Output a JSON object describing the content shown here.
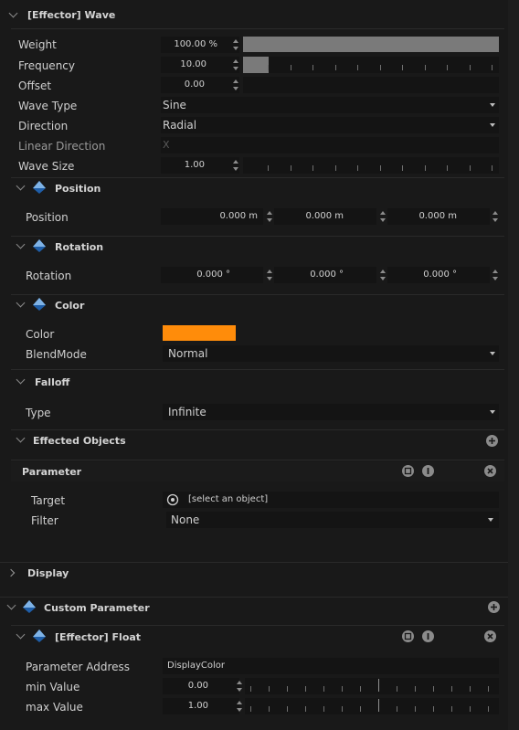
{
  "header": {
    "title": "[Effector] Wave"
  },
  "wave": {
    "weight": {
      "label": "Weight",
      "value": "100.00 %",
      "fill": 1.0
    },
    "frequency": {
      "label": "Frequency",
      "value": "10.00",
      "fill": 0.1
    },
    "offset": {
      "label": "Offset",
      "value": "0.00"
    },
    "wave_type": {
      "label": "Wave Type",
      "value": "Sine"
    },
    "direction": {
      "label": "Direction",
      "value": "Radial"
    },
    "linear_direction": {
      "label": "Linear Direction",
      "value": "X"
    },
    "wave_size": {
      "label": "Wave Size",
      "value": "1.00"
    }
  },
  "position": {
    "section": "Position",
    "label": "Position",
    "x": "0.000 m",
    "y": "0.000 m",
    "z": "0.000 m"
  },
  "rotation": {
    "section": "Rotation",
    "label": "Rotation",
    "x": "0.000 °",
    "y": "0.000 °",
    "z": "0.000 °"
  },
  "color": {
    "section": "Color",
    "label": "Color",
    "swatch": "#ff8c0a",
    "blendmode_label": "BlendMode",
    "blendmode": "Normal"
  },
  "falloff": {
    "section": "Falloff",
    "type_label": "Type",
    "type": "Infinite"
  },
  "effected": {
    "section": "Effected Objects",
    "parameter": "Parameter",
    "target_label": "Target",
    "target": "[select an object]",
    "filter_label": "Filter",
    "filter": "None"
  },
  "display": {
    "section": "Display"
  },
  "custom": {
    "section": "Custom Parameter",
    "float_title": "[Effector] Float",
    "address_label": "Parameter Address",
    "address": "DisplayColor",
    "min_label": "min Value",
    "min": "0.00",
    "max_label": "max Value",
    "max": "1.00"
  },
  "icons": {
    "effector_gem_top": "#7fb3e6",
    "effector_gem_bottom": "#1f5ea8",
    "accent": "#ff8c0a"
  }
}
